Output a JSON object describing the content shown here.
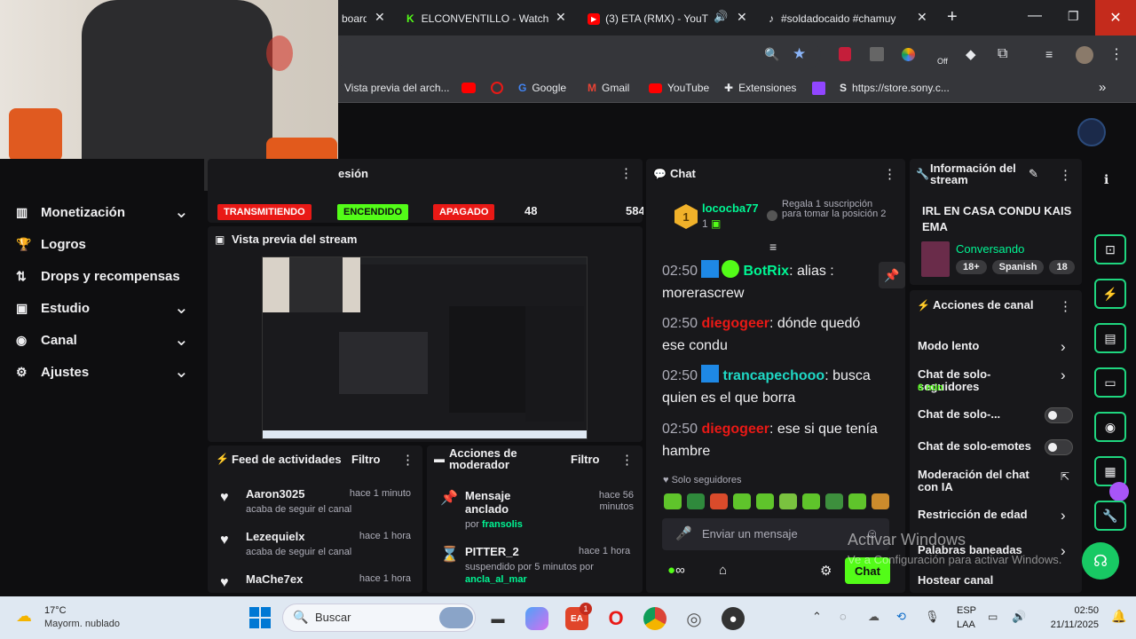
{
  "browser": {
    "tabs": [
      {
        "title": "board"
      },
      {
        "title": "ELCONVENTILLO - Watch"
      },
      {
        "title": "(3) ETA (RMX) - YouTu"
      },
      {
        "title": "#soldadocaido #chamuy"
      }
    ],
    "bookmarks": [
      "Vista previa del arch...",
      "Google",
      "Gmail",
      "YouTube",
      "Extensiones",
      "https://store.sony.c..."
    ],
    "off_label": "Off"
  },
  "sidebar": {
    "items": [
      {
        "label": "Monetización",
        "expand": true
      },
      {
        "label": "Logros",
        "expand": false
      },
      {
        "label": "Drops y recompensas",
        "expand": false
      },
      {
        "label": "Estudio",
        "expand": true
      },
      {
        "label": "Canal",
        "expand": true
      },
      {
        "label": "Ajustes",
        "expand": true
      }
    ]
  },
  "session": {
    "title": "esión",
    "badges": [
      "TRANSMITIENDO",
      "ENCENDIDO",
      "APAGADO"
    ],
    "value1": "48",
    "value2": "584"
  },
  "preview": {
    "title": "Vista previa del stream"
  },
  "feed": {
    "title": "Feed de actividades",
    "filter": "Filtro",
    "items": [
      {
        "name": "Aaron3025",
        "sub": "acaba de seguir el canal",
        "time": "hace 1 minuto"
      },
      {
        "name": "Lezequielx",
        "sub": "acaba de seguir el canal",
        "time": "hace 1 hora"
      },
      {
        "name": "MaChe7ex",
        "sub": "",
        "time": "hace 1 hora"
      }
    ]
  },
  "mod": {
    "title": "Acciones de moderador",
    "filter": "Filtro",
    "items": [
      {
        "name": "Mensaje anclado",
        "by_prefix": "por",
        "by": "fransolis",
        "time": "hace 56 minutos"
      },
      {
        "name": "PITTER_2",
        "by_prefix": "suspendido por 5 minutos por",
        "by": "ancla_al_mar",
        "time": "hace 1 hora"
      }
    ]
  },
  "chat": {
    "title": "Chat",
    "leader": {
      "rank": "1",
      "name": "lococba77",
      "count": "1",
      "cta": "Regala 1 suscripción para tomar la posición 2"
    },
    "messages": [
      {
        "time": "02:50",
        "user": "BotRix",
        "text": ": alias : morerascrew",
        "color": "#00f593"
      },
      {
        "time": "02:50",
        "user": "diegogeer",
        "text": ": dónde quedó ese condu",
        "color": "#e91916"
      },
      {
        "time": "02:50",
        "user": "trancapechooo",
        "text": ": busca quien es el que borra",
        "color": "#1fd8c5"
      },
      {
        "time": "02:50",
        "user": "diegogeer",
        "text": ": ese si que tenía hambre",
        "color": "#e91916"
      }
    ],
    "followers_only": "Solo seguidores",
    "placeholder": "Enviar un mensaje",
    "send": "Chat"
  },
  "info": {
    "title": "Información del stream",
    "stream_title": "IRL EN CASA CONDU KAIS EMA",
    "category": "Conversando",
    "tags": [
      "18+",
      "Spanish",
      "18"
    ]
  },
  "actions": {
    "title": "Acciones de canal",
    "items": [
      {
        "label": "Modo lento",
        "sub": "",
        "control": "chevron"
      },
      {
        "label": "Chat de solo-seguidores",
        "sub": "6 min",
        "control": "chevron"
      },
      {
        "label": "Chat de solo-...",
        "sub": "",
        "control": "toggle"
      },
      {
        "label": "Chat de solo-emotes",
        "sub": "",
        "control": "toggle"
      },
      {
        "label": "Moderación del chat con IA",
        "sub": "",
        "control": "external"
      },
      {
        "label": "Restricción de edad",
        "sub": "",
        "control": "chevron"
      },
      {
        "label": "Palabras baneadas",
        "sub": "",
        "control": "chevron"
      },
      {
        "label": "Hostear canal",
        "sub": "",
        "control": "none"
      }
    ]
  },
  "watermark": {
    "line1": "Activar Windows",
    "line2": "Ve a Configuración para activar Windows."
  },
  "taskbar": {
    "weather_temp": "17°C",
    "weather_desc": "Mayorm. nublado",
    "search": "Buscar",
    "lang1": "ESP",
    "lang2": "LAA",
    "time": "02:50",
    "date": "21/11/2025",
    "badge": "1"
  },
  "colors": {
    "accent": "#00f593",
    "live": "#e91916",
    "bg": "#0e0e10",
    "panel": "#18181b"
  }
}
